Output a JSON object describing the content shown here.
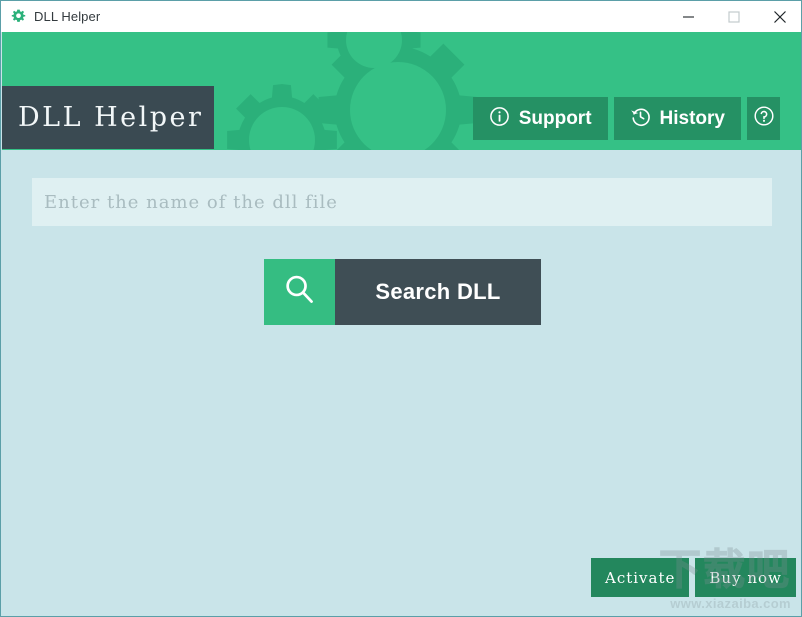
{
  "window": {
    "title": "DLL Helper",
    "app_icon": "gear-icon",
    "controls": {
      "minimize": "minimize-icon",
      "maximize": "maximize-icon",
      "close": "close-icon"
    }
  },
  "header": {
    "logo_text": "DLL Helper",
    "background_color": "#35c186",
    "logo_background_color": "#3a4a52",
    "button_color": "#259164",
    "actions": [
      {
        "label": "Support",
        "icon": "info-circle-icon"
      },
      {
        "label": "History",
        "icon": "history-clock-icon"
      },
      {
        "label": "",
        "icon": "question-circle-icon"
      }
    ]
  },
  "main": {
    "background_color": "#c9e4e9",
    "search": {
      "placeholder": "Enter the name of the dll file",
      "value": "",
      "button_label": "Search DLL",
      "button_icon": "search-icon",
      "button_icon_color": "#35bd82",
      "button_body_color": "#3f4e55"
    }
  },
  "footer": {
    "buttons": [
      {
        "label": "Activate"
      },
      {
        "label": "Buy now"
      }
    ],
    "button_color": "#23875d"
  },
  "watermark": {
    "text": "下载吧",
    "url": "www.xiazaiba.com"
  }
}
